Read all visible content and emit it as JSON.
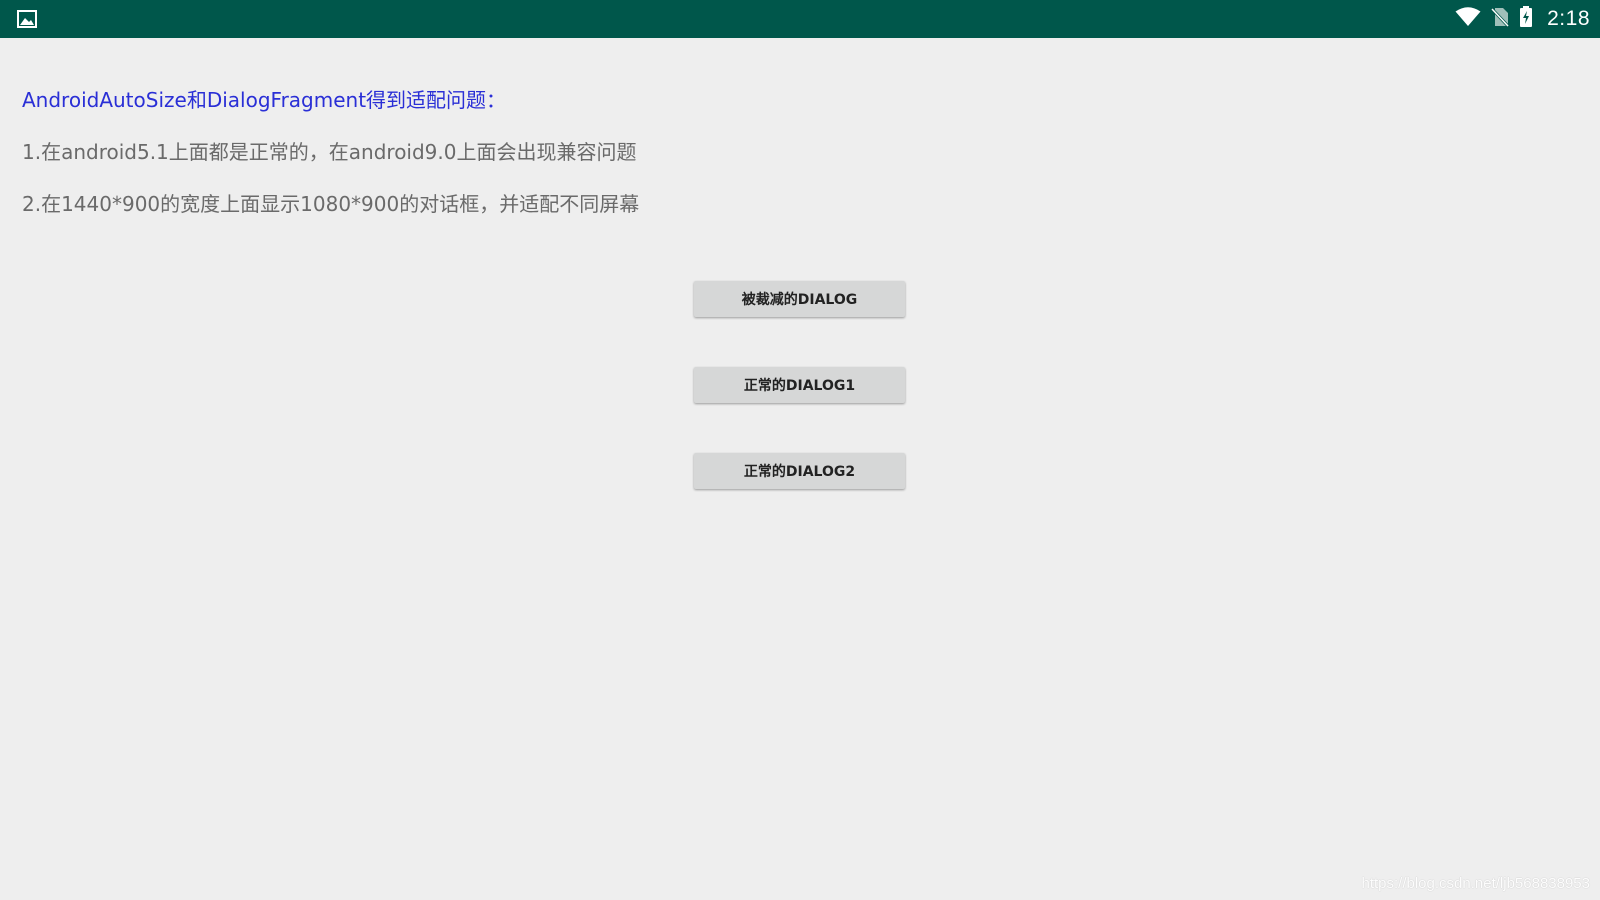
{
  "status_bar": {
    "time": "2:18",
    "icons": [
      "image-icon",
      "wifi-icon",
      "no-sim-icon",
      "battery-charging-icon"
    ],
    "background": "#00574b"
  },
  "main": {
    "title": "AndroidAutoSize和DialogFragment得到适配问题：",
    "lines": [
      "1.在android5.1上面都是正常的，在android9.0上面会出现兼容问题",
      "2.在1440*900的宽度上面显示1080*900的对话框，并适配不同屏幕"
    ],
    "title_color": "#2a2fd6",
    "text_color": "#6a6a6a"
  },
  "buttons": [
    {
      "label": "被裁减的DIALOG"
    },
    {
      "label": "正常的DIALOG1"
    },
    {
      "label": "正常的DIALOG2"
    }
  ],
  "watermark": "https://blog.csdn.net/ljb568838953",
  "colors": {
    "background": "#eeeeee",
    "button": "#d6d7d7"
  }
}
